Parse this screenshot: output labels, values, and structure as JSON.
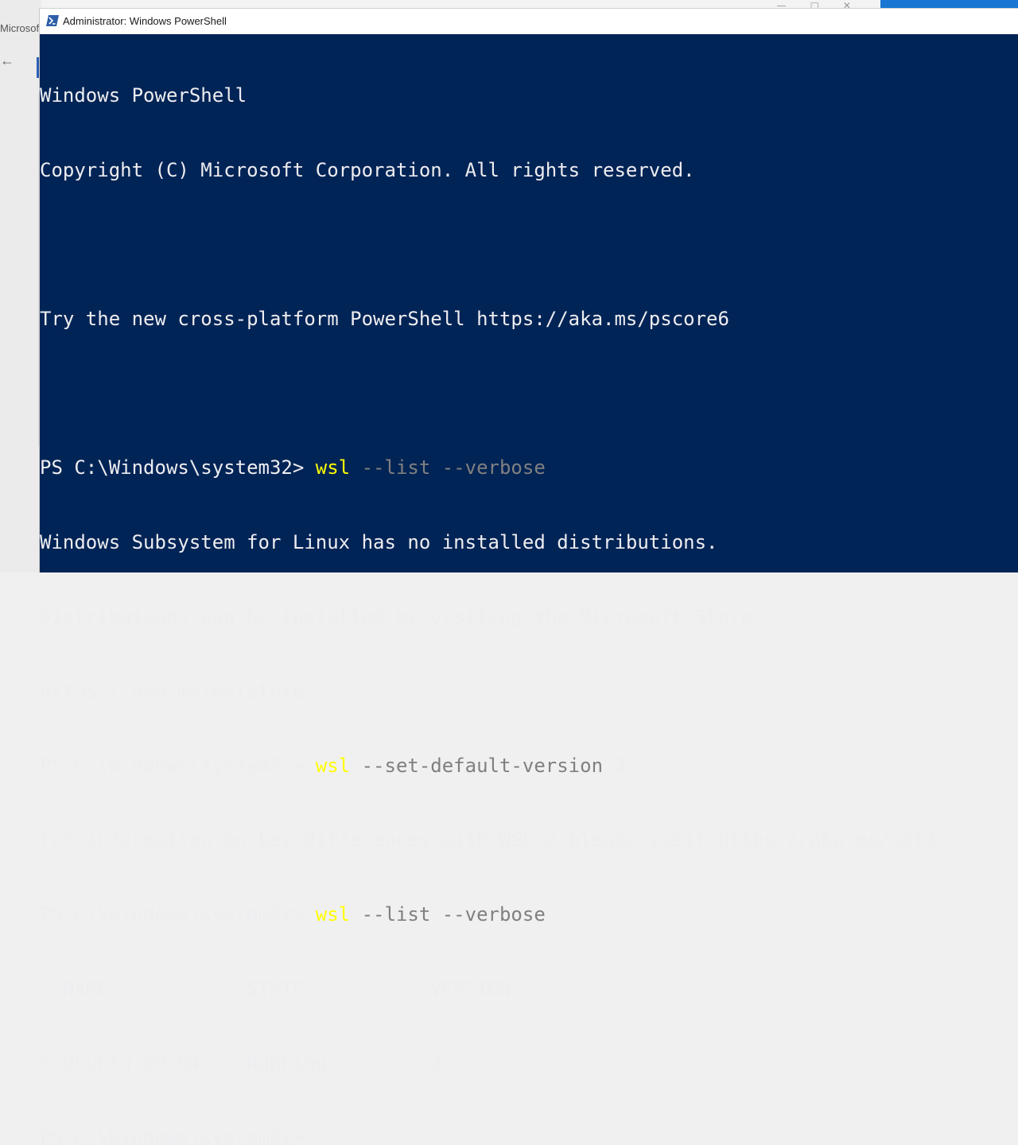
{
  "background_window": {
    "title_fragment": "Microsoft",
    "back_icon": "arrow-left-icon"
  },
  "window": {
    "title": "Administrator: Windows PowerShell",
    "icon": "powershell-icon",
    "background": "#012456",
    "text_color": "#eeedf0",
    "command_color": "#ffff00",
    "parameter_color": "#808080"
  },
  "console": {
    "lines": [
      {
        "text": "Windows PowerShell"
      },
      {
        "text": "Copyright (C) Microsoft Corporation. All rights reserved."
      },
      {
        "text": ""
      },
      {
        "text": "Try the new cross-platform PowerShell https://aka.ms/pscore6"
      },
      {
        "text": ""
      },
      {
        "prompt": "PS C:\\Windows\\system32> ",
        "command": "wsl",
        "args": " --list --verbose"
      },
      {
        "text": "Windows Subsystem for Linux has no installed distributions."
      },
      {
        "text": "Distributions can be installed by visiting the Microsoft Store:"
      },
      {
        "text": "https://aka.ms/wslstore"
      },
      {
        "prompt": "PS C:\\Windows\\system32> ",
        "command": "wsl",
        "args": " --set-default-version",
        "value": " 2"
      },
      {
        "text": "For information on key differences with WSL 2 please visit https://aka.ms/wsl2"
      },
      {
        "prompt": "PS C:\\Windows\\system32> ",
        "command": "wsl",
        "args": " --list --verbose"
      },
      {
        "text": "  NAME            STATE           VERSION"
      },
      {
        "text": "* Ubuntu-20.04    Running         2"
      },
      {
        "prompt": "PS C:\\Windows\\system32> "
      }
    ]
  }
}
